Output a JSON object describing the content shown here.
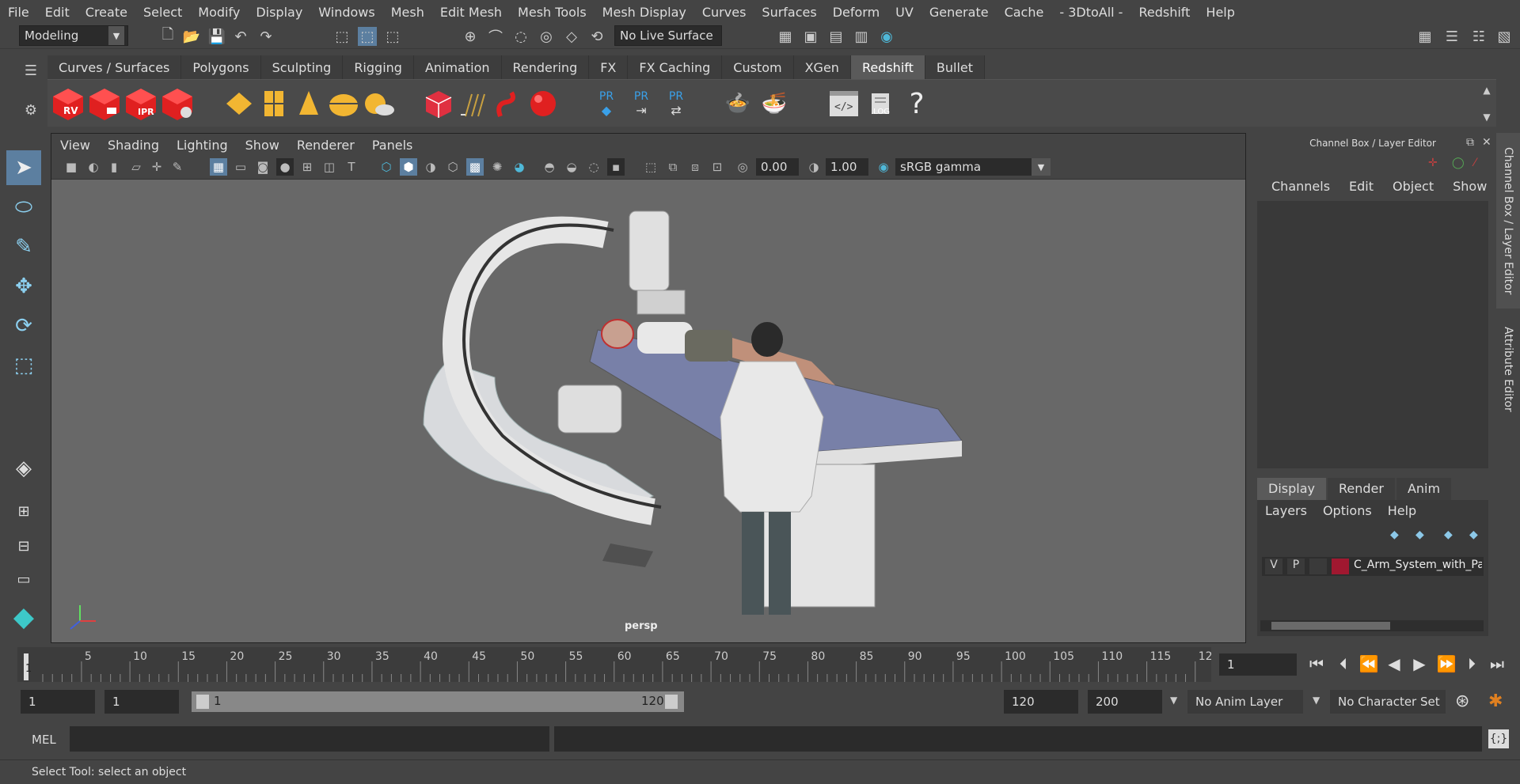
{
  "menu": [
    "File",
    "Edit",
    "Create",
    "Select",
    "Modify",
    "Display",
    "Windows",
    "Mesh",
    "Edit Mesh",
    "Mesh Tools",
    "Mesh Display",
    "Curves",
    "Surfaces",
    "Deform",
    "UV",
    "Generate",
    "Cache",
    "- 3DtoAll -",
    "Redshift",
    "Help"
  ],
  "status": {
    "mode": "Modeling",
    "live_surface": "No Live Surface"
  },
  "shelf_tabs": [
    "Curves / Surfaces",
    "Polygons",
    "Sculpting",
    "Rigging",
    "Animation",
    "Rendering",
    "FX",
    "FX Caching",
    "Custom",
    "XGen",
    "Redshift",
    "Bullet"
  ],
  "active_shelf_tab": "Redshift",
  "shelf_icons": {
    "rv": "RV",
    "ipr": "IPR",
    "pr": "PR",
    "log": ".LOG",
    "help": "?"
  },
  "viewport": {
    "menu": [
      "View",
      "Shading",
      "Lighting",
      "Show",
      "Renderer",
      "Panels"
    ],
    "exposure": "0.00",
    "gamma": "1.00",
    "color_space": "sRGB gamma",
    "camera_label": "persp"
  },
  "channel_box": {
    "title": "Channel Box / Layer Editor",
    "menu": [
      "Channels",
      "Edit",
      "Object",
      "Show"
    ],
    "layer_tabs": [
      "Display",
      "Render",
      "Anim"
    ],
    "active_layer_tab": "Display",
    "layer_menu": [
      "Layers",
      "Options",
      "Help"
    ],
    "layer": {
      "v": "V",
      "p": "P",
      "name": "C_Arm_System_with_Pa",
      "color": "#a01830"
    }
  },
  "side_tabs": [
    "Channel Box / Layer Editor",
    "Attribute Editor"
  ],
  "timeline": {
    "ticks": [
      "5",
      "10",
      "15",
      "20",
      "25",
      "30",
      "35",
      "40",
      "45",
      "50",
      "55",
      "60",
      "65",
      "70",
      "75",
      "80",
      "85",
      "90",
      "95",
      "100",
      "105",
      "110",
      "115",
      "12"
    ],
    "current_marker": "1",
    "current_frame": "1"
  },
  "range": {
    "start": "1",
    "playback_start": "1",
    "slider_start": "1",
    "slider_end": "120",
    "playback_end": "120",
    "end": "200",
    "anim_layer": "No Anim Layer",
    "character_set": "No Character Set"
  },
  "command": {
    "label": "MEL"
  },
  "help_line": "Select Tool: select an object"
}
